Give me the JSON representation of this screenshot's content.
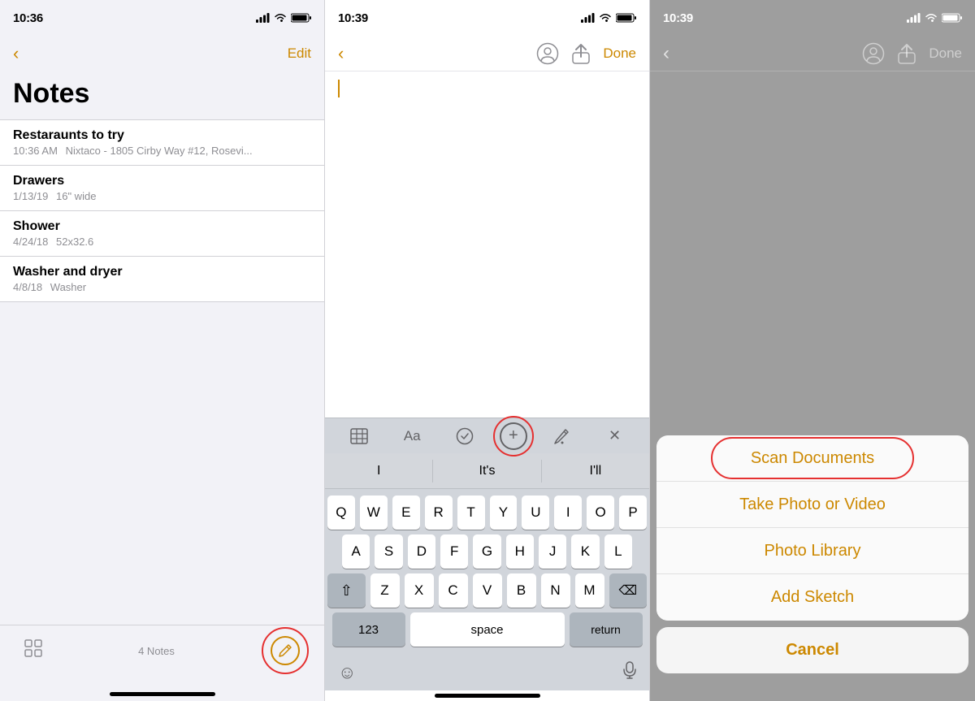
{
  "panel1": {
    "statusBar": {
      "time": "10:36",
      "locationIcon": "▶",
      "signal": "▋▋▋",
      "wifi": "WiFi",
      "battery": "🔋"
    },
    "navBar": {
      "backIcon": "‹",
      "editLabel": "Edit"
    },
    "title": "Notes",
    "notes": [
      {
        "title": "Restaraunts to try",
        "date": "10:36 AM",
        "preview": "Nixtaco - 1805 Cirby Way #12, Rosevi..."
      },
      {
        "title": "Drawers",
        "date": "1/13/19",
        "preview": "16\" wide"
      },
      {
        "title": "Shower",
        "date": "4/24/18",
        "preview": "52x32.6"
      },
      {
        "title": "Washer and dryer",
        "date": "4/8/18",
        "preview": "Washer"
      }
    ],
    "bottomBar": {
      "notesCount": "4 Notes",
      "gridIcon": "⊞",
      "composeIcon": "✏"
    }
  },
  "panel2": {
    "statusBar": {
      "time": "10:39",
      "locationIcon": "▶"
    },
    "navBar": {
      "backIcon": "‹",
      "doneLabel": "Done"
    },
    "toolbar": {
      "tableIcon": "⊞",
      "aaIcon": "Aa",
      "checkIcon": "⊙",
      "plusIcon": "+",
      "pencilIcon": "✏",
      "closeIcon": "✕"
    },
    "autocorrect": {
      "word1": "I",
      "word2": "It's",
      "word3": "I'll"
    },
    "keyboard": {
      "row1": [
        "Q",
        "W",
        "E",
        "R",
        "T",
        "Y",
        "U",
        "I",
        "O",
        "P"
      ],
      "row2": [
        "A",
        "S",
        "D",
        "F",
        "G",
        "H",
        "J",
        "K",
        "L"
      ],
      "row3": [
        "⇧",
        "Z",
        "X",
        "C",
        "V",
        "B",
        "N",
        "M",
        "⌫"
      ],
      "row4": [
        "123",
        "space",
        "return"
      ]
    },
    "bottomBar": {
      "emojiIcon": "☺",
      "micIcon": "🎤"
    }
  },
  "panel3": {
    "statusBar": {
      "time": "10:39",
      "locationIcon": "▶"
    },
    "navBar": {
      "backIcon": "‹",
      "doneLabel": "Done"
    },
    "actionSheet": {
      "items": [
        "Scan Documents",
        "Take Photo or Video",
        "Photo Library",
        "Add Sketch"
      ],
      "cancelLabel": "Cancel"
    }
  },
  "colors": {
    "gold": "#cc8800",
    "red": "#e53030",
    "gray": "#8e8e93",
    "keyBg": "#ffffff",
    "specialKeyBg": "#adb5bd"
  }
}
